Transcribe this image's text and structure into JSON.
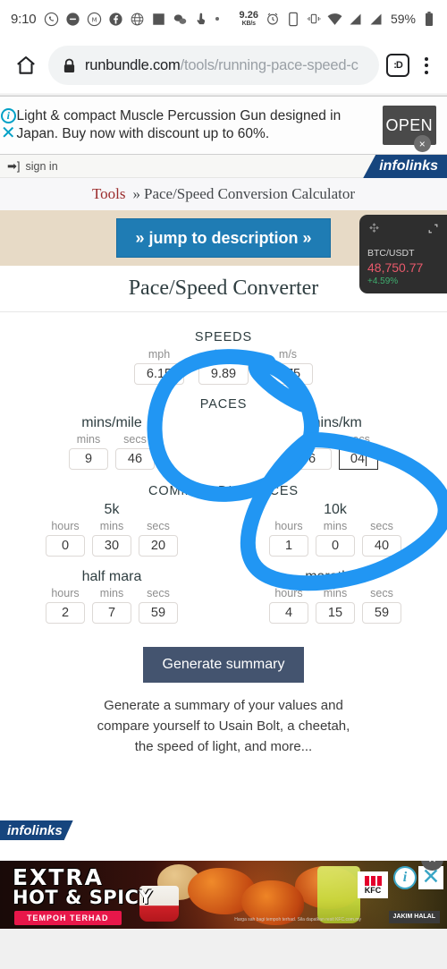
{
  "statusbar": {
    "time": "9:10",
    "icons": [
      "whatsapp-icon",
      "message-icon",
      "mewe-icon",
      "facebook-icon",
      "globe-icon",
      "square-icon",
      "wechat-icon",
      "touch-icon",
      "dot-icon"
    ],
    "data_rate": "9.26",
    "data_rate_unit": "KB/s",
    "right_icons": [
      "alarm-icon",
      "sim-icon",
      "vibrate-icon",
      "wifi-icon",
      "signal-icon",
      "signal2-icon"
    ],
    "battery": "59%"
  },
  "browser": {
    "home_icon": "home-icon",
    "lock_icon": "lock-icon",
    "url_domain": "runbundle.com",
    "url_path": "/tools/running-pace-speed-c",
    "profile_label": ":D",
    "menu_icon": "kebab-menu-icon"
  },
  "top_ad": {
    "text": "Light & compact Muscle Percussion Gun designed in Japan. Buy now with discount up to 60%.",
    "cta": "OPEN",
    "info_icon": "info-icon",
    "dismiss_icon": "close-icon",
    "corner_close": "×"
  },
  "signin": {
    "label": "sign in",
    "icon": "sign-in-icon",
    "brand": "infolinks"
  },
  "breadcrumb": {
    "root": "Tools",
    "separator": "»",
    "current": "Pace/Speed Conversion Calculator"
  },
  "jump": {
    "label": "» jump to description »"
  },
  "converter": {
    "title": "Pace/Speed Converter",
    "sections": {
      "speeds": "SPEEDS",
      "paces": "PACES",
      "distances": "COMMON DISTANCES"
    },
    "speeds": [
      {
        "label": "mph",
        "value": "6.15"
      },
      {
        "label": "kph",
        "value": "9.89"
      },
      {
        "label": "m/s",
        "value": "2.75"
      }
    ],
    "paces": [
      {
        "title": "mins/mile",
        "fields": [
          {
            "label": "mins",
            "value": "9",
            "focused": false
          },
          {
            "label": "secs",
            "value": "46",
            "focused": false
          }
        ]
      },
      {
        "title": "mins/km",
        "fields": [
          {
            "label": "mins",
            "value": "6",
            "focused": false
          },
          {
            "label": "secs",
            "value": "04",
            "focused": true
          }
        ]
      }
    ],
    "distances": [
      {
        "title": "5k",
        "fields": [
          {
            "label": "hours",
            "value": "0"
          },
          {
            "label": "mins",
            "value": "30"
          },
          {
            "label": "secs",
            "value": "20"
          }
        ]
      },
      {
        "title": "10k",
        "fields": [
          {
            "label": "hours",
            "value": "1"
          },
          {
            "label": "mins",
            "value": "0"
          },
          {
            "label": "secs",
            "value": "40"
          }
        ]
      },
      {
        "title": "half mara",
        "fields": [
          {
            "label": "hours",
            "value": "2"
          },
          {
            "label": "mins",
            "value": "7"
          },
          {
            "label": "secs",
            "value": "59"
          }
        ]
      },
      {
        "title": "marathon",
        "fields": [
          {
            "label": "hours",
            "value": "4"
          },
          {
            "label": "mins",
            "value": "15"
          },
          {
            "label": "secs",
            "value": "59"
          }
        ]
      }
    ],
    "generate_button": "Generate summary",
    "generate_desc": "Generate a summary of your values and compare yourself to Usain Bolt, a cheetah, the speed of light, and more..."
  },
  "crypto": {
    "logo": "binance-icon",
    "expand_icon": "expand-icon",
    "pair": "BTC/USDT",
    "price": "48,750.77",
    "change": "+4.59%"
  },
  "bottom_ad": {
    "brand_tab": "infolinks",
    "line1": "EXTRA",
    "line2": "HOT & SPICY",
    "badge": "TEMPOH TERHAD",
    "kfc_label": "KFC",
    "halal": "JAKIM HALAL",
    "fine_print": "Harga sah bagi tempoh terhad. Sila dapatkan resit KFC.com.my",
    "info_icon": "info-icon",
    "close_icon": "close-icon",
    "round_close": "×"
  },
  "annotation": {
    "color": "#2196f3",
    "shapes": [
      "circle-around-speeds",
      "circle-around-mins-per-km"
    ]
  }
}
